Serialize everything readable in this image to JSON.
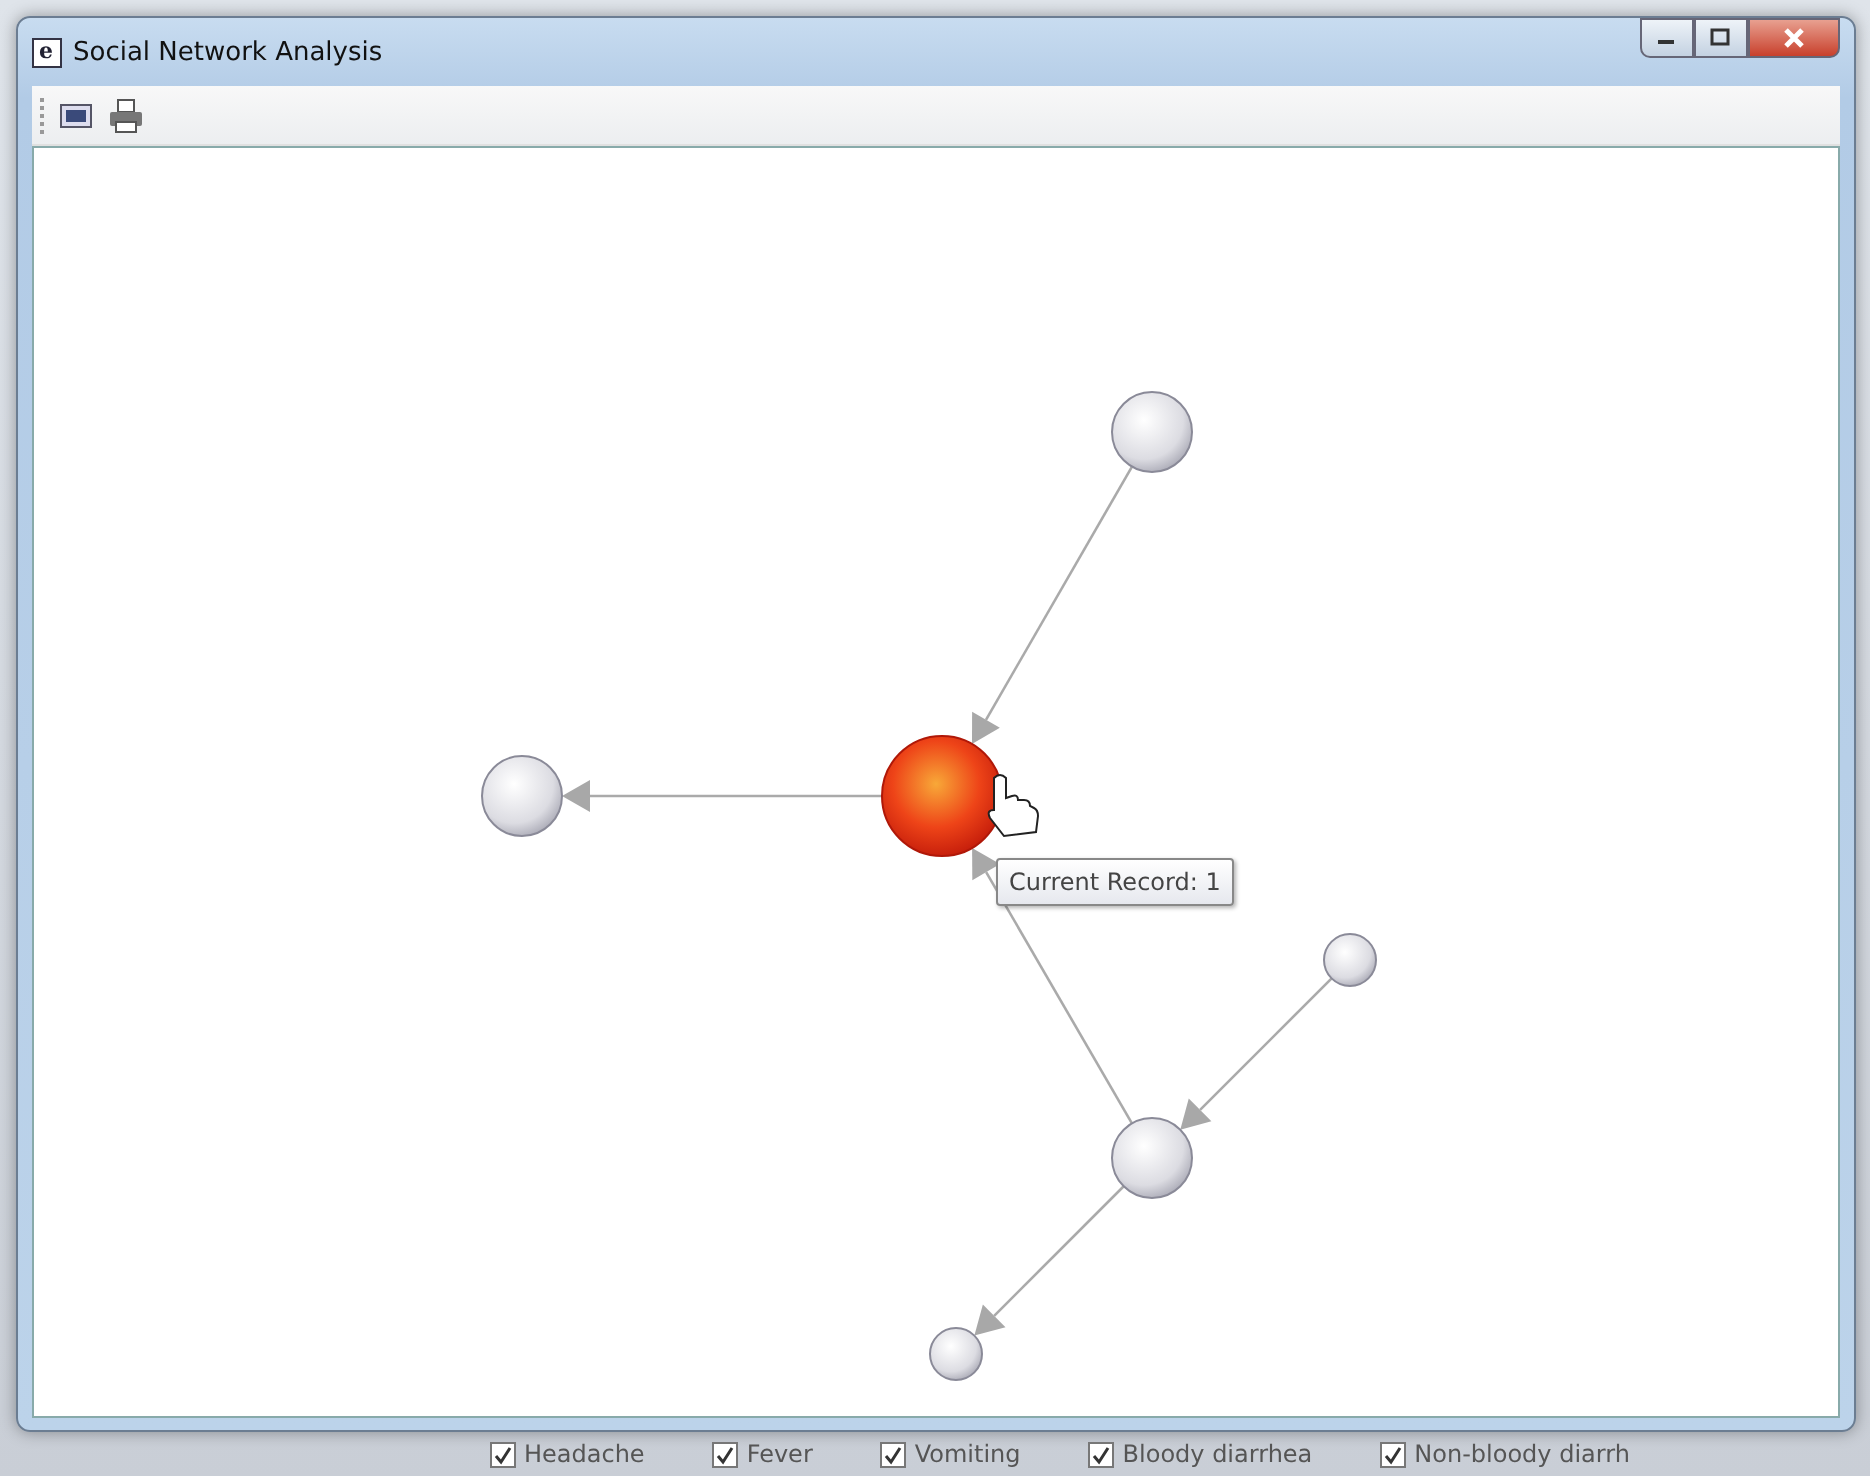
{
  "window": {
    "icon_letter": "e",
    "title": "Social Network Analysis"
  },
  "toolbar": {
    "buttons": [
      {
        "kind": "image"
      },
      {
        "kind": "print"
      }
    ]
  },
  "graph": {
    "nodes": [
      {
        "selected": true
      },
      {
        "selected": false
      },
      {
        "selected": false
      },
      {
        "selected": false
      },
      {
        "selected": false
      },
      {
        "selected": false
      }
    ],
    "tooltip": "Current Record: 1"
  },
  "background_form": {
    "checkboxes": [
      {
        "label": "Headache",
        "checked": true
      },
      {
        "label": "Fever",
        "checked": true
      },
      {
        "label": "Vomiting",
        "checked": true
      },
      {
        "label": "Bloody diarrhea",
        "checked": true
      },
      {
        "label": "Non-bloody diarrh",
        "checked": true
      }
    ]
  }
}
